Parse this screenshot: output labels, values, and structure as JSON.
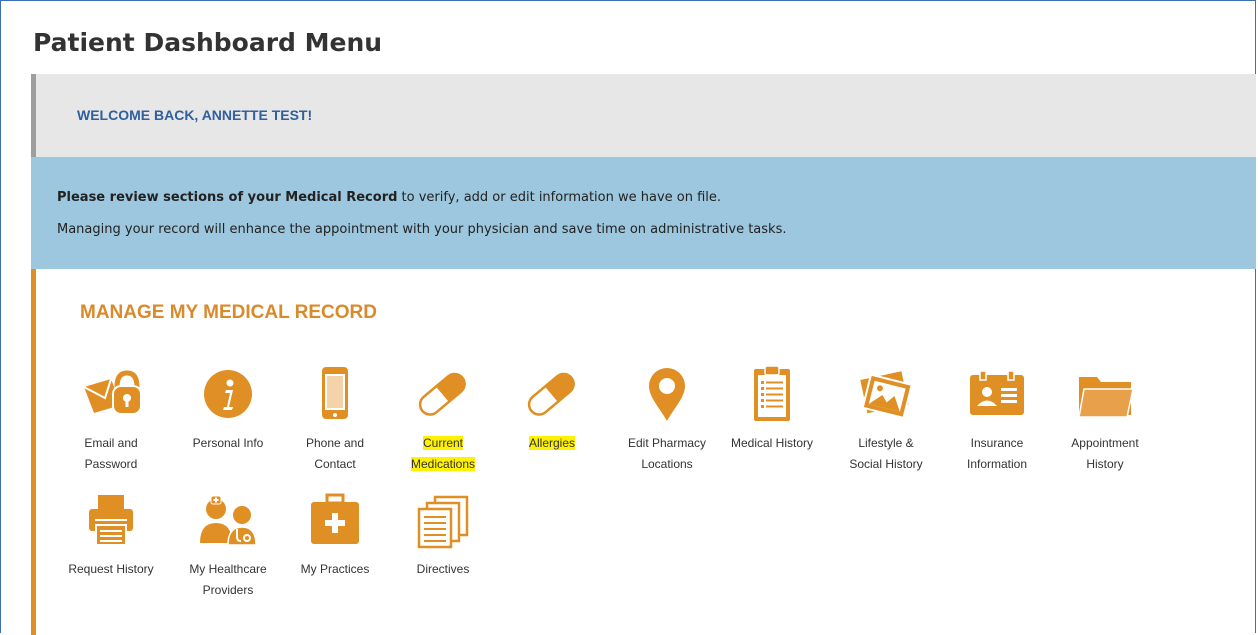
{
  "page_title": "Patient Dashboard Menu",
  "welcome": "WELCOME BACK, ANNETTE TEST!",
  "info": {
    "line1_bold": "Please review sections of your Medical Record",
    "line1_rest": " to verify, add or edit information we have on file.",
    "line2": "Managing your record will enhance the appointment with your physician and save time on administrative tasks."
  },
  "manage_title": "MANAGE MY MEDICAL RECORD",
  "colors": {
    "accent": "#E08F24",
    "heading_blue": "#2F5F9E",
    "info_bg": "#9CC7DE",
    "highlight": "#FFF200"
  },
  "tiles": [
    {
      "label_1": "Email and",
      "label_2": "Password",
      "icon": "lock-envelope-icon",
      "highlighted": false
    },
    {
      "label_1": "Personal Info",
      "label_2": "",
      "icon": "info-icon",
      "highlighted": false
    },
    {
      "label_1": "Phone and",
      "label_2": "Contact",
      "icon": "phone-icon",
      "highlighted": false
    },
    {
      "label_1": "Current",
      "label_2": "Medications",
      "icon": "pill-icon",
      "highlighted": true
    },
    {
      "label_1": "Allergies",
      "label_2": "",
      "icon": "pill-icon",
      "highlighted": true
    },
    {
      "label_1": "Edit Pharmacy",
      "label_2": "Locations",
      "icon": "map-pin-icon",
      "highlighted": false
    },
    {
      "label_1": "Medical History",
      "label_2": "",
      "icon": "clipboard-icon",
      "highlighted": false
    },
    {
      "label_1": "Lifestyle &",
      "label_2": "Social History",
      "icon": "photos-icon",
      "highlighted": false
    },
    {
      "label_1": "Insurance",
      "label_2": "Information",
      "icon": "id-card-icon",
      "highlighted": false
    },
    {
      "label_1": "Appointment",
      "label_2": "History",
      "icon": "folder-icon",
      "highlighted": false
    },
    {
      "label_1": "Request History",
      "label_2": "",
      "icon": "printer-icon",
      "highlighted": false
    },
    {
      "label_1": "My Healthcare",
      "label_2": "Providers",
      "icon": "doctors-icon",
      "highlighted": false
    },
    {
      "label_1": "My Practices",
      "label_2": "",
      "icon": "first-aid-kit-icon",
      "highlighted": false
    },
    {
      "label_1": "Directives",
      "label_2": "",
      "icon": "documents-icon",
      "highlighted": false
    }
  ]
}
